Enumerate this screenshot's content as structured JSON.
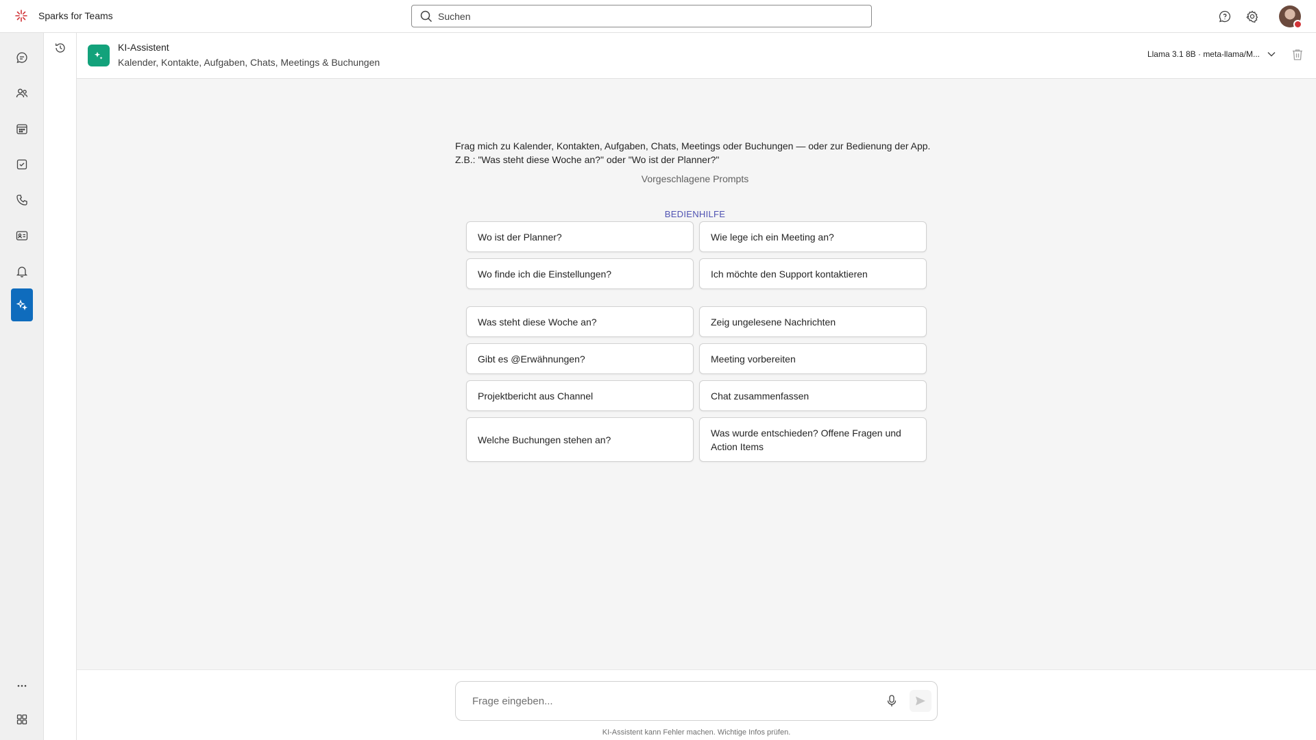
{
  "app": {
    "title": "Sparks for Teams"
  },
  "search": {
    "placeholder": "Suchen"
  },
  "colors": {
    "accent": "#0f6cbd",
    "bot": "#13a27b",
    "brand": "#d13438",
    "section": "#4f52b2"
  },
  "topbar": {
    "icons": [
      "help-icon",
      "settings-icon"
    ]
  },
  "rail": {
    "items": [
      {
        "icon": "chat-icon"
      },
      {
        "icon": "people-icon"
      },
      {
        "icon": "calendar-icon"
      },
      {
        "icon": "tasks-icon"
      },
      {
        "icon": "phone-icon"
      },
      {
        "icon": "contact-card-icon"
      },
      {
        "icon": "bell-icon"
      },
      {
        "icon": "ai-sparkle-icon",
        "active": true
      }
    ],
    "bottom": [
      {
        "icon": "more-icon"
      },
      {
        "icon": "apps-icon"
      }
    ]
  },
  "header": {
    "title": "KI-Assistent",
    "subtitle": "Kalender, Kontakte, Aufgaben, Chats, Meetings & Buchungen",
    "model": "Llama 3.1 8B · meta-llama/M..."
  },
  "intro": {
    "line1": "Frag mich zu Kalender, Kontakten, Aufgaben, Chats, Meetings oder Buchungen — oder zur Bedienung der App.",
    "line2": "Z.B.: \"Was steht diese Woche an?\" oder \"Wo ist der Planner?\"",
    "suggested": "Vorgeschlagene Prompts"
  },
  "help_section": {
    "label": "BEDIENHILFE",
    "prompts": [
      "Wo ist der Planner?",
      "Wie lege ich ein Meeting an?",
      "Wo finde ich die Einstellungen?",
      "Ich möchte den Support kontaktieren"
    ]
  },
  "general_prompts": [
    "Was steht diese Woche an?",
    "Zeig ungelesene Nachrichten",
    "Gibt es @Erwähnungen?",
    "Meeting vorbereiten",
    "Projektbericht aus Channel",
    "Chat zusammenfassen",
    "Welche Buchungen stehen an?",
    "Was wurde entschieden? Offene Fragen und Action Items"
  ],
  "composer": {
    "placeholder": "Frage eingeben...",
    "disclaimer": "KI-Assistent kann Fehler machen. Wichtige Infos prüfen."
  }
}
